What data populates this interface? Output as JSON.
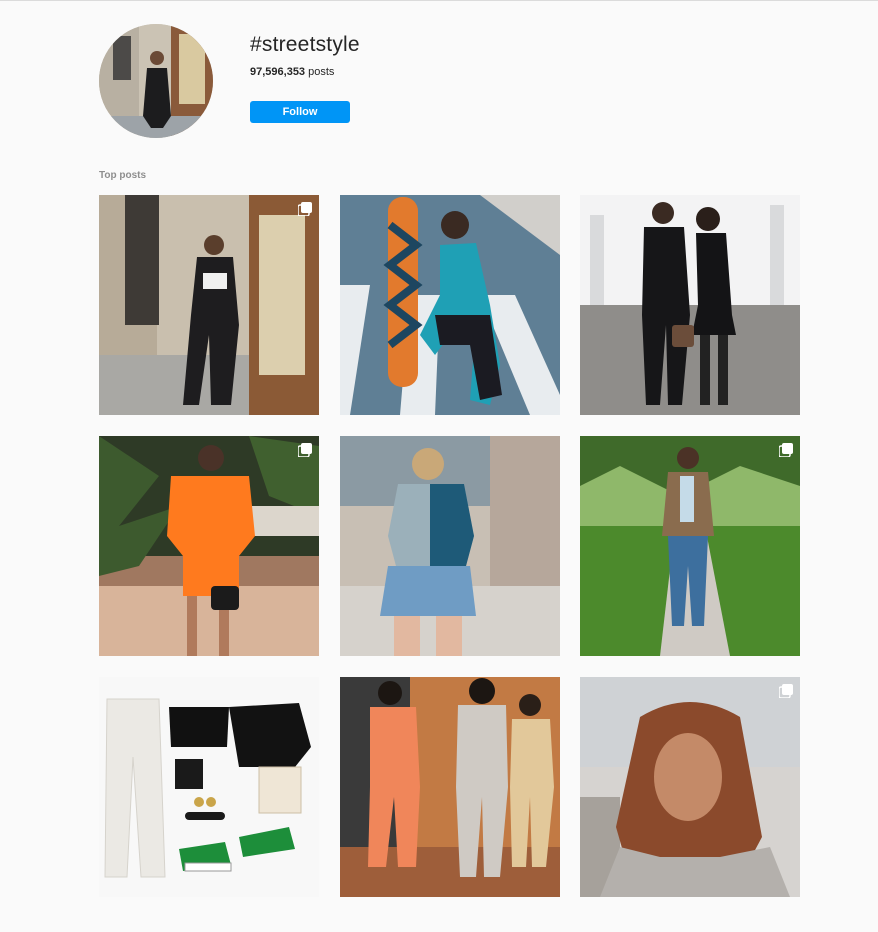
{
  "header": {
    "hashtag": "#streetstyle",
    "post_count": "97,596,353",
    "post_count_suffix": " posts",
    "follow_label": "Follow",
    "avatar_icon": "profile-photo"
  },
  "top_posts": {
    "section_label": "Top posts",
    "posts": [
      {
        "label": "woman in black outfit by door",
        "multi": true
      },
      {
        "label": "woman with skateboard on crosswalk",
        "multi": false
      },
      {
        "label": "couple in black outfits",
        "multi": false
      },
      {
        "label": "woman in orange oversized tee",
        "multi": true
      },
      {
        "label": "woman in denim shorts",
        "multi": false
      },
      {
        "label": "man in patterned blazer",
        "multi": true
      },
      {
        "label": "outfit flat lay collage",
        "multi": false
      },
      {
        "label": "three friends in tracksuits",
        "multi": false
      },
      {
        "label": "woman selfie",
        "multi": true
      }
    ]
  }
}
